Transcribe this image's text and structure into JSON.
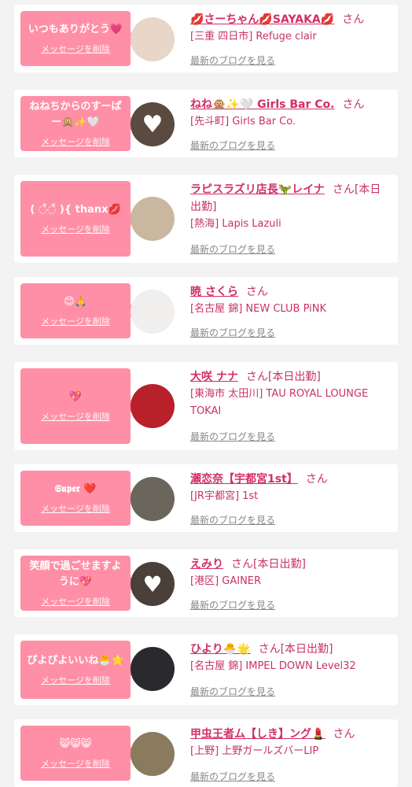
{
  "cards": [
    {
      "message": "いつもありがとう💗",
      "delete_label": "メッセージを削除",
      "name": "💋さーちゃん💋SAYAKA💋",
      "honorific": "さん",
      "shop": "[三重 四日市] Refuge clair",
      "blog_label": "最新のブログを見る",
      "avatar_color": "#e8d6c8"
    },
    {
      "message": "ねねちからのすーぱー🙊✨🤍",
      "delete_label": "メッセージを削除",
      "name": "ねね🙊✨🤍 Girls Bar Co.",
      "honorific": "さん",
      "shop": "[先斗町] Girls Bar Co.",
      "blog_label": "最新のブログを見る",
      "avatar_color": "#5a4a40"
    },
    {
      "message": "( ◌̊◌̊ ){ thanx💋",
      "delete_label": "メッセージを削除",
      "name": "ラピスラズリ店長🦖レイナ",
      "honorific": "さん[本日出勤]",
      "shop": "[熱海] Lapis Lazuli",
      "blog_label": "最新のブログを見る",
      "avatar_color": "#c9b7a0"
    },
    {
      "message": "😊🙏",
      "delete_label": "メッセージを削除",
      "name": "暁 さくら",
      "honorific": "さん",
      "shop": "[名古屋 錦] NEW CLUB PiNK",
      "blog_label": "最新のブログを見る",
      "avatar_color": "#f1eeee"
    },
    {
      "message": "💖",
      "delete_label": "メッセージを削除",
      "name": "大咲 ナナ",
      "honorific": "さん[本日出勤]",
      "shop": "[東海市 太田川] TAU ROYAL LOUNGE TOKAI",
      "blog_label": "最新のブログを見る",
      "avatar_color": "#b8202a"
    },
    {
      "message": "𝕾𝖚𝖕𝖊𝖗 ❤️",
      "delete_label": "メッセージを削除",
      "name": "瀬恋奈【宇都宮1st】",
      "honorific": "さん",
      "shop": "[JR宇都宮] 1st",
      "blog_label": "最新のブログを見る",
      "avatar_color": "#6b665c"
    },
    {
      "message": "笑顔で過ごせますように💖",
      "delete_label": "メッセージを削除",
      "name": "えみり",
      "honorific": "さん[本日出勤]",
      "shop": "[港区] GAINER",
      "blog_label": "最新のブログを見る",
      "avatar_color": "#4b3f3a"
    },
    {
      "message": "ぴよぴよいいね🐣⭐",
      "delete_label": "メッセージを削除",
      "name": "ひより🐣🌟",
      "honorific": "さん[本日出勤]",
      "shop": "[名古屋 錦] IMPEL DOWN Level32",
      "blog_label": "最新のブログを見る",
      "avatar_color": "#2a2a2e"
    },
    {
      "message": "😸😸😸",
      "delete_label": "メッセージを削除",
      "name": "甲虫王者ム【しき】ング💄",
      "honorific": "さん",
      "shop": "[上野] 上野ガールズバーLIP",
      "blog_label": "最新のブログを見る",
      "avatar_color": "#8a7a5e"
    }
  ]
}
